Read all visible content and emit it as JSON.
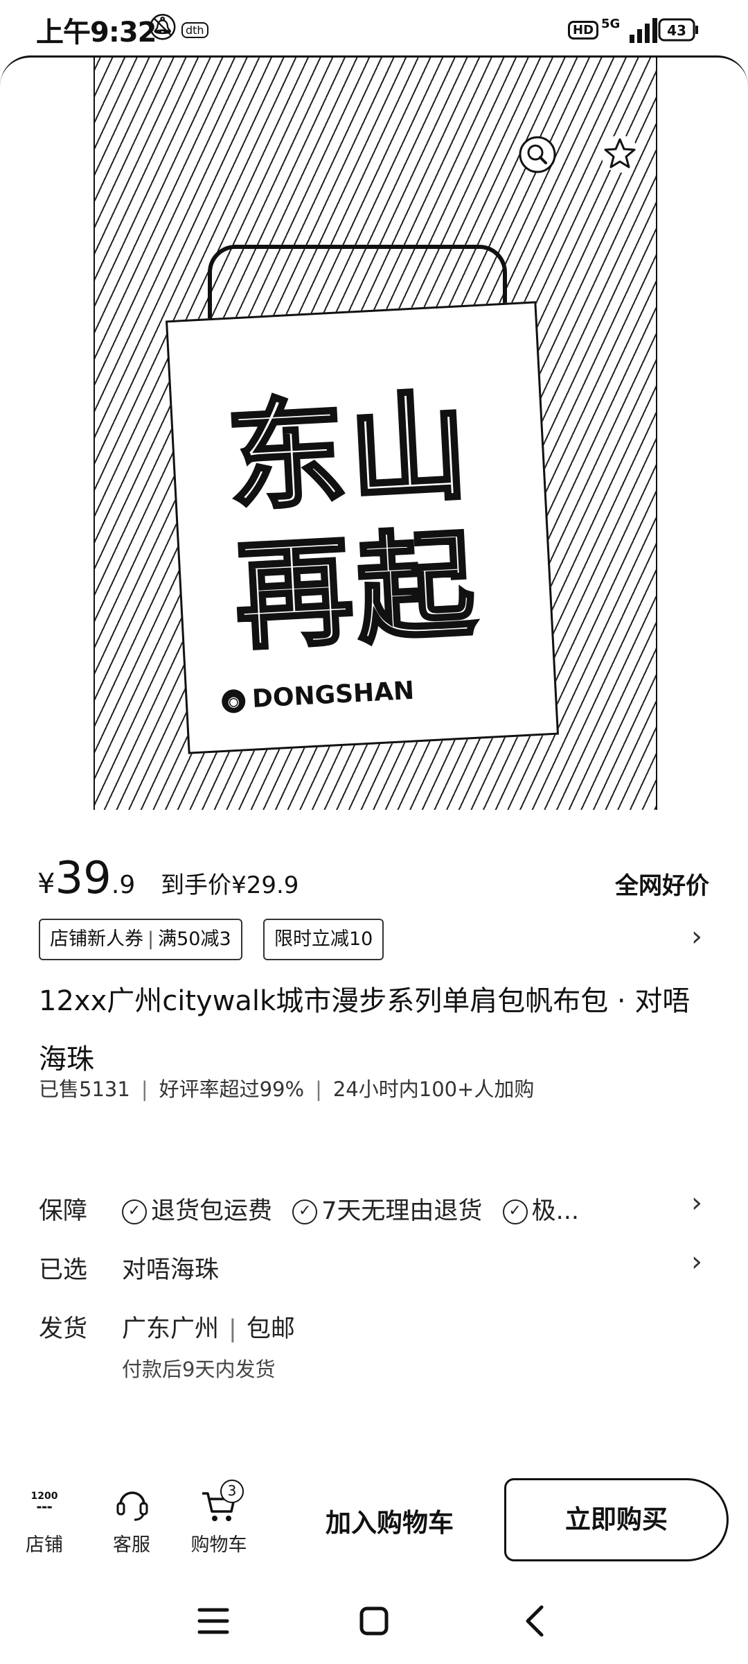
{
  "status_bar": {
    "time": "上午9:32",
    "mute_icon": "bell-off-icon",
    "extra_icon_label": "dth",
    "hd": "HD",
    "network": "5G",
    "battery": "43"
  },
  "hero": {
    "tote_text_line1": "东山",
    "tote_text_line2": "再起",
    "tote_brand": "DONGSHAN",
    "search_icon": "image-search-icon",
    "star_icon": "star-icon"
  },
  "price": {
    "currency": "¥",
    "integer": "39",
    "decimal": ".9",
    "final_label": "到手价",
    "final_price": "¥29.9",
    "badge": "全网好价"
  },
  "coupons": [
    {
      "name": "店铺新人券",
      "detail": "满50减3"
    },
    {
      "name": "限时立减10"
    }
  ],
  "product": {
    "title": "12xx广州citywalk城市漫步系列单肩包帆布包 · 对唔海珠",
    "sold": "已售5131",
    "rating": "好评率超过99%",
    "cart_adds": "24小时内100+人加购"
  },
  "guarantee": {
    "label": "保障",
    "items": [
      "退货包运费",
      "7天无理由退货",
      "极..."
    ]
  },
  "selected": {
    "label": "已选",
    "value": "对唔海珠"
  },
  "shipping": {
    "label": "发货",
    "location": "广东广州",
    "fee": "包邮",
    "note": "付款后9天内发货"
  },
  "bottom_bar": {
    "shop_logo": "1200",
    "shop_label": "店铺",
    "service_label": "客服",
    "cart_label": "购物车",
    "cart_count": "3",
    "add_to_cart": "加入购物车",
    "buy_now": "立即购买"
  }
}
